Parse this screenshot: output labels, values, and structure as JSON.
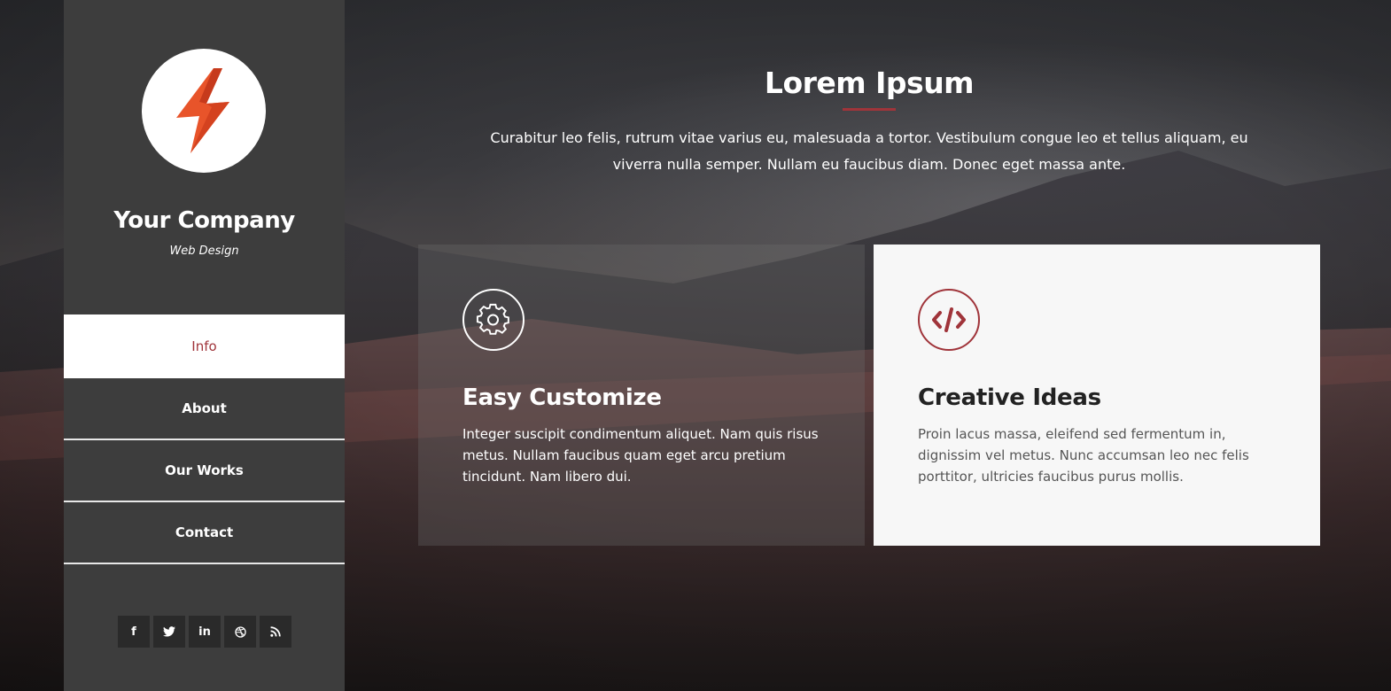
{
  "sidebar": {
    "company_name": "Your Company",
    "tagline": "Web Design",
    "logo_icon": "lightning-bolt-icon",
    "nav": [
      {
        "label": "Info",
        "active": true
      },
      {
        "label": "About",
        "active": false
      },
      {
        "label": "Our Works",
        "active": false
      },
      {
        "label": "Contact",
        "active": false
      }
    ],
    "social": [
      {
        "icon": "facebook-icon",
        "glyph": "f"
      },
      {
        "icon": "twitter-icon",
        "glyph": "t"
      },
      {
        "icon": "linkedin-icon",
        "glyph": "in"
      },
      {
        "icon": "dribbble-icon",
        "glyph": "⊛"
      },
      {
        "icon": "rss-icon",
        "glyph": "◥"
      }
    ]
  },
  "main": {
    "title": "Lorem Ipsum",
    "intro": "Curabitur leo felis, rutrum vitae varius eu, malesuada a tortor. Vestibulum congue leo et tellus aliquam, eu viverra nulla semper. Nullam eu faucibus diam. Donec eget massa ante.",
    "cards": [
      {
        "icon": "gear-icon",
        "title": "Easy Customize",
        "text": "Integer suscipit condimentum aliquet. Nam quis risus metus. Nullam faucibus quam eget arcu pretium tincidunt. Nam libero dui."
      },
      {
        "icon": "code-icon",
        "title": "Creative Ideas",
        "text": "Proin lacus massa, eleifend sed fermentum in, dignissim vel metus. Nunc accumsan leo nec felis porttitor, ultricies faucibus purus mollis."
      }
    ]
  },
  "colors": {
    "accent": "#a0343a",
    "sidebar_bg": "#3d3d3d",
    "logo_orange": "#e8542a"
  }
}
